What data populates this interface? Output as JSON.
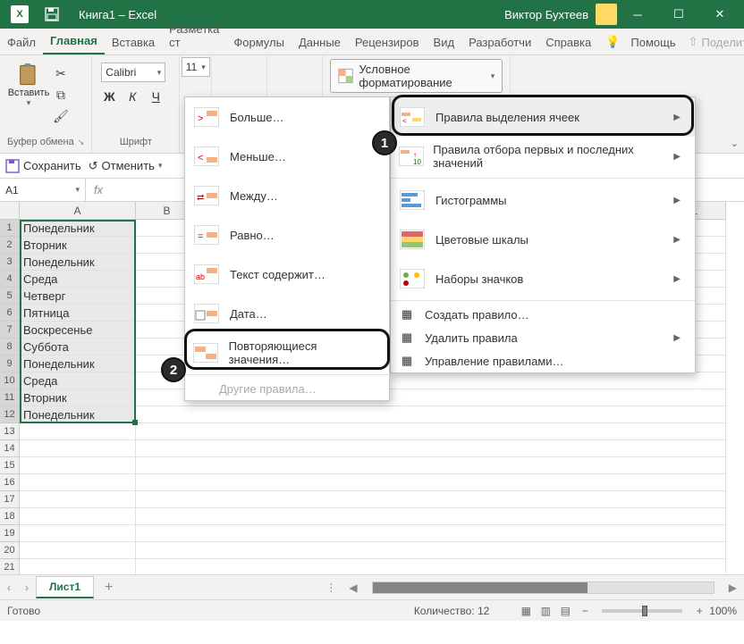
{
  "titlebar": {
    "title": "Книга1 – Excel",
    "user": "Виктор Бухтеев"
  },
  "tabs": {
    "file": "Файл",
    "home": "Главная",
    "insert": "Вставка",
    "pagelayout": "Разметка ст",
    "formulas": "Формулы",
    "data": "Данные",
    "review": "Рецензиров",
    "view": "Вид",
    "developer": "Разработчи",
    "help": "Справка",
    "assist": "Помощь",
    "share": "Поделиться"
  },
  "ribbon": {
    "paste": "Вставить",
    "clipboard": "Буфер обмена",
    "font_group": "Шрифт",
    "font_name": "Calibri",
    "font_size": "11",
    "cond_fmt": "Условное форматирование"
  },
  "quickbar": {
    "save": "Сохранить",
    "undo": "Отменить"
  },
  "namebox": "A1",
  "columns": [
    "A",
    "B",
    "L"
  ],
  "cells": [
    "Понедельник",
    "Вторник",
    "Понедельник",
    "Среда",
    "Четверг",
    "Пятница",
    "Воскресенье",
    "Суббота",
    "Понедельник",
    "Среда",
    "Вторник",
    "Понедельник"
  ],
  "sheet": {
    "tab1": "Лист1"
  },
  "status": {
    "ready": "Готово",
    "count_label": "Количество:",
    "count_value": "12",
    "zoom": "100%"
  },
  "menu_cond": {
    "highlight": "Правила выделения ячеек",
    "toptbottom": "Правила отбора первых и последних значений",
    "databars": "Гистограммы",
    "colorscales": "Цветовые шкалы",
    "iconsets": "Наборы значков",
    "newrule": "Создать правило…",
    "clear": "Удалить правила",
    "manage": "Управление правилами…"
  },
  "menu_hl": {
    "greater": "Больше…",
    "less": "Меньше…",
    "between": "Между…",
    "equal": "Равно…",
    "textcontains": "Текст содержит…",
    "date": "Дата…",
    "duplicates": "Повторяющиеся значения…",
    "more": "Другие правила…"
  },
  "badges": {
    "one": "1",
    "two": "2"
  }
}
